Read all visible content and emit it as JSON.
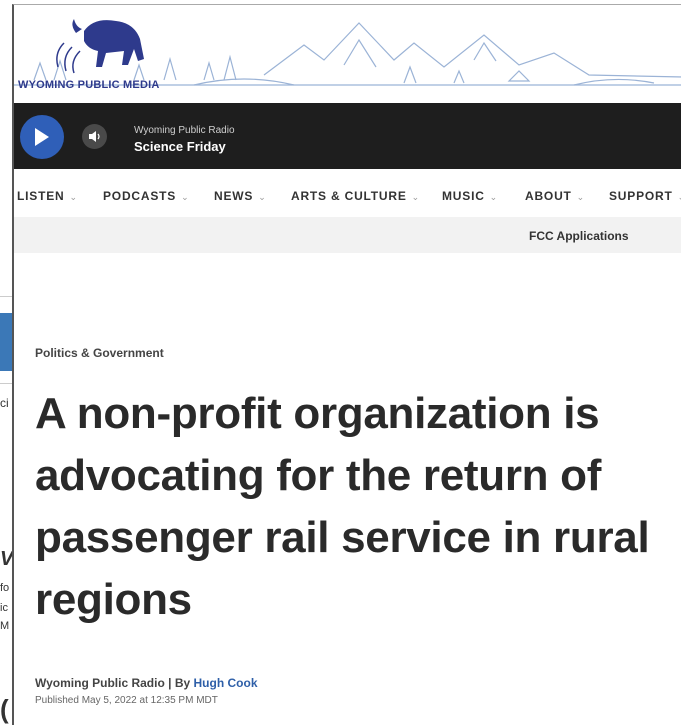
{
  "background_fragments": [
    "ci",
    "V",
    "fo",
    "ic",
    "M",
    "("
  ],
  "header": {
    "brand": "WYOMING PUBLIC MEDIA"
  },
  "player": {
    "station": "Wyoming Public Radio",
    "program": "Science Friday"
  },
  "nav": {
    "items": [
      "LISTEN",
      "PODCASTS",
      "NEWS",
      "ARTS & CULTURE",
      "MUSIC",
      "ABOUT",
      "SUPPORT"
    ],
    "sub_link": "FCC Applications"
  },
  "article": {
    "category": "Politics & Government",
    "headline": "A non-profit organization is advocating for the return of passenger rail service in rural regions",
    "byline_source": "Wyoming Public Radio",
    "byline_sep": " | By ",
    "author": "Hugh Cook",
    "published": "Published May 5, 2022 at 12:35 PM MDT"
  },
  "colors": {
    "brand": "#2e3a8c",
    "player_bg": "#1e1e1e",
    "play_button": "#2f5fb8",
    "author_link": "#2e5fa8"
  },
  "icons": [
    "bison-logo",
    "mountain-illustration",
    "play-icon",
    "volume-icon",
    "chevron-down-icon"
  ]
}
